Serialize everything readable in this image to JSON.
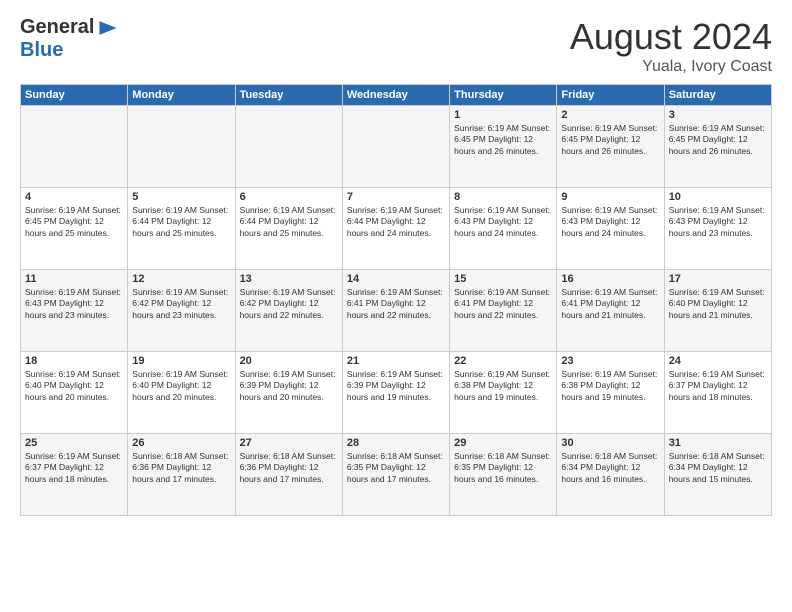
{
  "logo": {
    "general": "General",
    "blue": "Blue"
  },
  "title": "August 2024",
  "subtitle": "Yuala, Ivory Coast",
  "days_of_week": [
    "Sunday",
    "Monday",
    "Tuesday",
    "Wednesday",
    "Thursday",
    "Friday",
    "Saturday"
  ],
  "weeks": [
    [
      {
        "day": "",
        "info": ""
      },
      {
        "day": "",
        "info": ""
      },
      {
        "day": "",
        "info": ""
      },
      {
        "day": "",
        "info": ""
      },
      {
        "day": "1",
        "info": "Sunrise: 6:19 AM\nSunset: 6:45 PM\nDaylight: 12 hours\nand 26 minutes."
      },
      {
        "day": "2",
        "info": "Sunrise: 6:19 AM\nSunset: 6:45 PM\nDaylight: 12 hours\nand 26 minutes."
      },
      {
        "day": "3",
        "info": "Sunrise: 6:19 AM\nSunset: 6:45 PM\nDaylight: 12 hours\nand 26 minutes."
      }
    ],
    [
      {
        "day": "4",
        "info": "Sunrise: 6:19 AM\nSunset: 6:45 PM\nDaylight: 12 hours\nand 25 minutes."
      },
      {
        "day": "5",
        "info": "Sunrise: 6:19 AM\nSunset: 6:44 PM\nDaylight: 12 hours\nand 25 minutes."
      },
      {
        "day": "6",
        "info": "Sunrise: 6:19 AM\nSunset: 6:44 PM\nDaylight: 12 hours\nand 25 minutes."
      },
      {
        "day": "7",
        "info": "Sunrise: 6:19 AM\nSunset: 6:44 PM\nDaylight: 12 hours\nand 24 minutes."
      },
      {
        "day": "8",
        "info": "Sunrise: 6:19 AM\nSunset: 6:43 PM\nDaylight: 12 hours\nand 24 minutes."
      },
      {
        "day": "9",
        "info": "Sunrise: 6:19 AM\nSunset: 6:43 PM\nDaylight: 12 hours\nand 24 minutes."
      },
      {
        "day": "10",
        "info": "Sunrise: 6:19 AM\nSunset: 6:43 PM\nDaylight: 12 hours\nand 23 minutes."
      }
    ],
    [
      {
        "day": "11",
        "info": "Sunrise: 6:19 AM\nSunset: 6:43 PM\nDaylight: 12 hours\nand 23 minutes."
      },
      {
        "day": "12",
        "info": "Sunrise: 6:19 AM\nSunset: 6:42 PM\nDaylight: 12 hours\nand 23 minutes."
      },
      {
        "day": "13",
        "info": "Sunrise: 6:19 AM\nSunset: 6:42 PM\nDaylight: 12 hours\nand 22 minutes."
      },
      {
        "day": "14",
        "info": "Sunrise: 6:19 AM\nSunset: 6:41 PM\nDaylight: 12 hours\nand 22 minutes."
      },
      {
        "day": "15",
        "info": "Sunrise: 6:19 AM\nSunset: 6:41 PM\nDaylight: 12 hours\nand 22 minutes."
      },
      {
        "day": "16",
        "info": "Sunrise: 6:19 AM\nSunset: 6:41 PM\nDaylight: 12 hours\nand 21 minutes."
      },
      {
        "day": "17",
        "info": "Sunrise: 6:19 AM\nSunset: 6:40 PM\nDaylight: 12 hours\nand 21 minutes."
      }
    ],
    [
      {
        "day": "18",
        "info": "Sunrise: 6:19 AM\nSunset: 6:40 PM\nDaylight: 12 hours\nand 20 minutes."
      },
      {
        "day": "19",
        "info": "Sunrise: 6:19 AM\nSunset: 6:40 PM\nDaylight: 12 hours\nand 20 minutes."
      },
      {
        "day": "20",
        "info": "Sunrise: 6:19 AM\nSunset: 6:39 PM\nDaylight: 12 hours\nand 20 minutes."
      },
      {
        "day": "21",
        "info": "Sunrise: 6:19 AM\nSunset: 6:39 PM\nDaylight: 12 hours\nand 19 minutes."
      },
      {
        "day": "22",
        "info": "Sunrise: 6:19 AM\nSunset: 6:38 PM\nDaylight: 12 hours\nand 19 minutes."
      },
      {
        "day": "23",
        "info": "Sunrise: 6:19 AM\nSunset: 6:38 PM\nDaylight: 12 hours\nand 19 minutes."
      },
      {
        "day": "24",
        "info": "Sunrise: 6:19 AM\nSunset: 6:37 PM\nDaylight: 12 hours\nand 18 minutes."
      }
    ],
    [
      {
        "day": "25",
        "info": "Sunrise: 6:19 AM\nSunset: 6:37 PM\nDaylight: 12 hours\nand 18 minutes."
      },
      {
        "day": "26",
        "info": "Sunrise: 6:18 AM\nSunset: 6:36 PM\nDaylight: 12 hours\nand 17 minutes."
      },
      {
        "day": "27",
        "info": "Sunrise: 6:18 AM\nSunset: 6:36 PM\nDaylight: 12 hours\nand 17 minutes."
      },
      {
        "day": "28",
        "info": "Sunrise: 6:18 AM\nSunset: 6:35 PM\nDaylight: 12 hours\nand 17 minutes."
      },
      {
        "day": "29",
        "info": "Sunrise: 6:18 AM\nSunset: 6:35 PM\nDaylight: 12 hours\nand 16 minutes."
      },
      {
        "day": "30",
        "info": "Sunrise: 6:18 AM\nSunset: 6:34 PM\nDaylight: 12 hours\nand 16 minutes."
      },
      {
        "day": "31",
        "info": "Sunrise: 6:18 AM\nSunset: 6:34 PM\nDaylight: 12 hours\nand 15 minutes."
      }
    ]
  ]
}
